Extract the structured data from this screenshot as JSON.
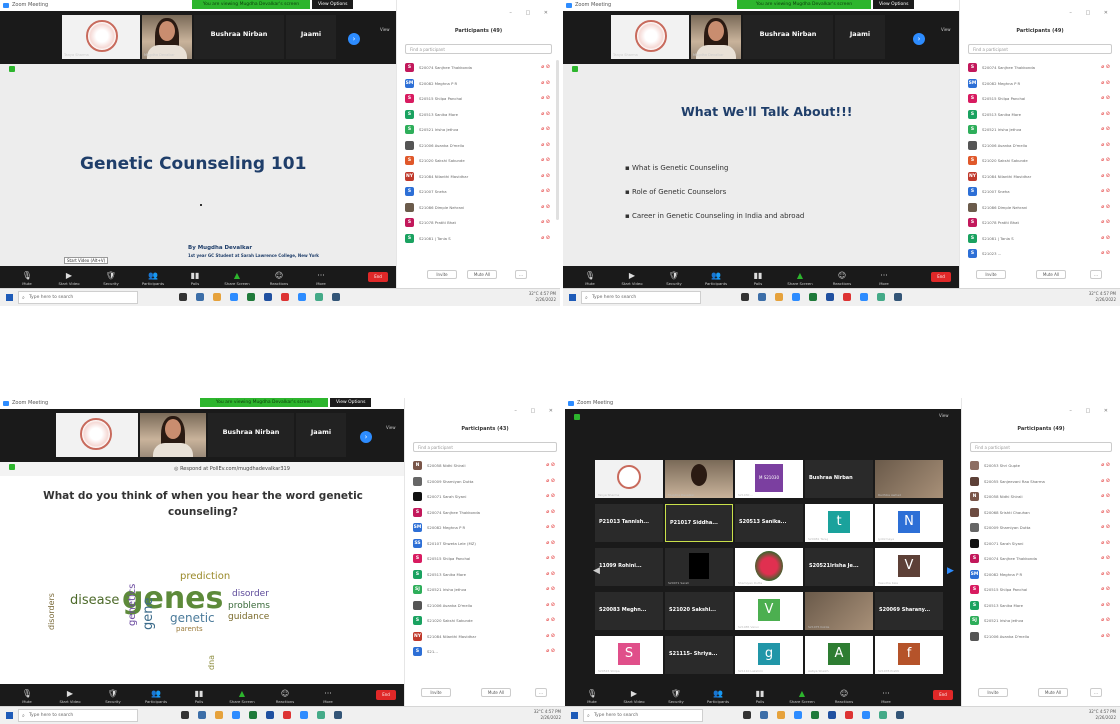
{
  "common": {
    "app_title": "Zoom Meeting",
    "share_banner": "You are viewing Mugdha Devalkar's screen",
    "view_options": "View Options",
    "view_label": "View",
    "panel_controls": "–  □  ✕",
    "search_placeholder": "Find a participant",
    "invite": "Invite",
    "mute_all": "Mute All",
    "end": "End",
    "taskbar_search": "Type here to search",
    "weather": "32°C",
    "time": "4:57 PM",
    "date": "2/26/2022",
    "toolbar": [
      "Mute",
      "Start Video",
      "Security",
      "Participants",
      "Polls",
      "Share Screen",
      "Reactions",
      "More"
    ]
  },
  "tiles": {
    "logo_name": "Tanya Sharma",
    "girl_name": "Mugdha Devalkar",
    "bushraa": "Bushraa Nirban",
    "jaami": "Jaami"
  },
  "q1": {
    "participants_title": "Participants (49)",
    "slide_title": "Genetic Counseling 101",
    "author": "By Mugdha Devalkar",
    "author_sub": "1st year GC Student at Sarah Lawrence College, New York",
    "start_video_tooltip": "Start Video (Alt+V)",
    "participants": [
      {
        "initial": "S",
        "color": "#c2185b",
        "name": "S20074 Sanjhee Thakkonda"
      },
      {
        "initial": "SM",
        "color": "#2d6fd6",
        "name": "S20082 Meghna P R"
      },
      {
        "initial": "S",
        "color": "#d81b60",
        "name": "S20515 Shilpa Panchal"
      },
      {
        "initial": "S",
        "color": "#1aa260",
        "name": "S20513 Sanika More"
      },
      {
        "initial": "S",
        "color": "#2eae5a",
        "name": "S20521 Irisha Jethva"
      },
      {
        "initial": "",
        "color": "#555555",
        "name": "S21006 Avanka D'mello"
      },
      {
        "initial": "S",
        "color": "#e0582a",
        "name": "S21020 Sakshi Sakunde"
      },
      {
        "initial": "NY",
        "color": "#c0392b",
        "name": "S21084 Nilanthi Mavidhar"
      },
      {
        "initial": "S",
        "color": "#2d6fd6",
        "name": "S21007 Sneha"
      },
      {
        "initial": "",
        "color": "#6b5b4b",
        "name": "S21086 Dimple Nehrani"
      },
      {
        "initial": "S",
        "color": "#c2185b",
        "name": "S21078 Pratiti Bhat"
      },
      {
        "initial": "S",
        "color": "#1aa260",
        "name": "S21081 | Tania S"
      }
    ]
  },
  "q2": {
    "participants_title": "Participants (49)",
    "slide_title": "What We'll Talk About!!!",
    "bullets": [
      "What is Genetic Counseling",
      "Role of Genetic Counselors",
      "Career in Genetic Counseling in India and abroad"
    ],
    "participants": [
      {
        "initial": "S",
        "color": "#c2185b",
        "name": "S20074 Sanjhee Thakkonda"
      },
      {
        "initial": "SM",
        "color": "#2d6fd6",
        "name": "S20082 Meghna P R"
      },
      {
        "initial": "S",
        "color": "#d81b60",
        "name": "S20515 Shilpa Panchal"
      },
      {
        "initial": "S",
        "color": "#1aa260",
        "name": "S20513 Sanika More"
      },
      {
        "initial": "S",
        "color": "#2eae5a",
        "name": "S20521 Irisha Jethva"
      },
      {
        "initial": "",
        "color": "#555555",
        "name": "S21006 Avanka D'mello"
      },
      {
        "initial": "S",
        "color": "#e0582a",
        "name": "S21020 Sakshi Sakunde"
      },
      {
        "initial": "NY",
        "color": "#c0392b",
        "name": "S21084 Nilanthi Mavidhar"
      },
      {
        "initial": "S",
        "color": "#2d6fd6",
        "name": "S21007 Sneha"
      },
      {
        "initial": "",
        "color": "#6b5b4b",
        "name": "S21086 Dimple Nehrani"
      },
      {
        "initial": "S",
        "color": "#c2185b",
        "name": "S21078 Pratiti Bhat"
      },
      {
        "initial": "S",
        "color": "#1aa260",
        "name": "S21081 | Tania S"
      },
      {
        "initial": "S",
        "color": "#2d6fd6",
        "name": "S21023 ..."
      }
    ]
  },
  "q3": {
    "participants_title": "Participants (43)",
    "respond": "Respond at PollEv.com/mugdhadevalkar319",
    "question": "What do you think of when you hear the word genetic counseling?",
    "words": [
      "genes",
      "disease",
      "genetics",
      "gene",
      "prediction",
      "disorder",
      "problems",
      "genetic",
      "guidance",
      "disorders",
      "parents",
      "dna"
    ],
    "participants": [
      {
        "initial": "N",
        "color": "#795548",
        "name": "S20058 Nidhi Shirali"
      },
      {
        "initial": "",
        "color": "#666666",
        "name": "S20009 Shamiyan Dutta"
      },
      {
        "initial": "",
        "color": "#111111",
        "name": "S20071 Sarah Siyani"
      },
      {
        "initial": "S",
        "color": "#c2185b",
        "name": "S20074 Sanjhee Thakkonda"
      },
      {
        "initial": "SM",
        "color": "#2d6fd6",
        "name": "S20082 Meghna P R"
      },
      {
        "initial": "SS",
        "color": "#2d6fd6",
        "name": "S20107 Shweta Lele (MZ)"
      },
      {
        "initial": "S",
        "color": "#d81b60",
        "name": "S20515 Shilpa Panchal"
      },
      {
        "initial": "S",
        "color": "#1aa260",
        "name": "S20513 Sanika More"
      },
      {
        "initial": "SJ",
        "color": "#2eae5a",
        "name": "S20521 Irisha Jethva"
      },
      {
        "initial": "",
        "color": "#555555",
        "name": "S21006 Avanka D'mello"
      },
      {
        "initial": "S",
        "color": "#1aa260",
        "name": "S21020 Sakshi Sakunde"
      },
      {
        "initial": "NY",
        "color": "#c0392b",
        "name": "S21084 Nilanthi Mavidhar"
      },
      {
        "initial": "S",
        "color": "#2d6fd6",
        "name": "S21..."
      }
    ]
  },
  "q4": {
    "participants_title": "Participants (49)",
    "grid": [
      {
        "name": "",
        "sub": "Tanya Sharma",
        "kind": "logo"
      },
      {
        "name": "",
        "sub": "Mugdha Devalkar",
        "kind": "girl"
      },
      {
        "name": "",
        "sub": "S21030 ...",
        "kind": "purple",
        "tag": "M S21030"
      },
      {
        "name": "Bushraa Nirban",
        "sub": "",
        "kind": "dark"
      },
      {
        "name": "",
        "sub": "Radhika Awhad",
        "kind": "photo"
      },
      {
        "name": "P21013 Tannish...",
        "sub": "",
        "kind": "dark"
      },
      {
        "name": "P21017 Siddha...",
        "sub": "",
        "kind": "dark",
        "active": true
      },
      {
        "name": "S20513 Sanika...",
        "sub": "",
        "kind": "dark"
      },
      {
        "name": "",
        "sub": "S20081 Tanuj",
        "kind": "letter",
        "letter": "t",
        "bg": "#1aa29c"
      },
      {
        "name": "",
        "sub": "Jyotirmaya",
        "kind": "letter",
        "letter": "N",
        "bg": "#2d6fd6"
      },
      {
        "name": "11099 Rohini...",
        "sub": "",
        "kind": "dark"
      },
      {
        "name": "",
        "sub": "S20071 Sarah",
        "kind": "black"
      },
      {
        "name": "",
        "sub": "Shamiyan Dutta",
        "kind": "flower"
      },
      {
        "name": "S20521Irisha Je...",
        "sub": "",
        "kind": "dark"
      },
      {
        "name": "",
        "sub": "Vasudha Kale",
        "kind": "letter",
        "letter": "V",
        "bg": "#5d4037"
      },
      {
        "name": "S20083 Meghn...",
        "sub": "",
        "kind": "dark"
      },
      {
        "name": "S21020 Sakshi...",
        "sub": "",
        "kind": "dark"
      },
      {
        "name": "",
        "sub": "S21085 Varun",
        "kind": "letter",
        "letter": "V",
        "bg": "#4caf50"
      },
      {
        "name": "",
        "sub": "S21075 Kokila",
        "kind": "photo"
      },
      {
        "name": "S20069 Sharany...",
        "sub": "",
        "kind": "dark"
      },
      {
        "name": "",
        "sub": "S20515 Shilpa",
        "kind": "letter",
        "letter": "S",
        "bg": "#e04f8a"
      },
      {
        "name": "S21115- Shriya...",
        "sub": "",
        "kind": "dark"
      },
      {
        "name": "",
        "sub": "S21110 Lakshmi",
        "kind": "letter",
        "letter": "g",
        "bg": "#2196a8"
      },
      {
        "name": "",
        "sub": "Aatiya Shaikh",
        "kind": "letter",
        "letter": "A",
        "bg": "#2e7d32"
      },
      {
        "name": "",
        "sub": "S21078 Pratiti",
        "kind": "letter",
        "letter": "f",
        "bg": "#b5532a"
      }
    ],
    "participants": [
      {
        "initial": "",
        "color": "#8d6e63",
        "name": "S20053 Shri Gupte"
      },
      {
        "initial": "",
        "color": "#5d4037",
        "name": "S20055 Sanjeevani Rao Sharma"
      },
      {
        "initial": "N",
        "color": "#795548",
        "name": "S20058 Nidhi Shirali"
      },
      {
        "initial": "",
        "color": "#6d4c41",
        "name": "S20068 Srishti Chauhan"
      },
      {
        "initial": "",
        "color": "#666666",
        "name": "S20009 Shamiyan Dutta"
      },
      {
        "initial": "",
        "color": "#111111",
        "name": "S20071 Sarah Siyani"
      },
      {
        "initial": "S",
        "color": "#c2185b",
        "name": "S20074 Sanjhee Thakkonda"
      },
      {
        "initial": "SM",
        "color": "#2d6fd6",
        "name": "S20082 Meghna P R"
      },
      {
        "initial": "S",
        "color": "#d81b60",
        "name": "S20515 Shilpa Panchal"
      },
      {
        "initial": "S",
        "color": "#1aa260",
        "name": "S20513 Sanika More"
      },
      {
        "initial": "SJ",
        "color": "#2eae5a",
        "name": "S20521 Irisha Jethva"
      },
      {
        "initial": "",
        "color": "#555555",
        "name": "S21006 Avanka D'mello"
      }
    ]
  }
}
